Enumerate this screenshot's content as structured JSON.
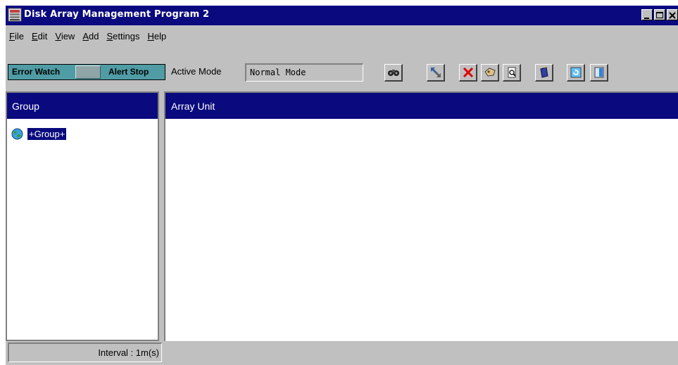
{
  "window": {
    "title": "Disk Array Management Program 2",
    "controls": [
      "minimize-icon",
      "maximize-icon",
      "close-icon"
    ]
  },
  "menu": [
    {
      "label": "File",
      "mnemonic": "F",
      "rest": "ile"
    },
    {
      "label": "Edit",
      "mnemonic": "E",
      "rest": "dit"
    },
    {
      "label": "View",
      "mnemonic": "V",
      "rest": "iew"
    },
    {
      "label": "Add",
      "mnemonic": "A",
      "rest": "dd"
    },
    {
      "label": "Settings",
      "mnemonic": "S",
      "rest": "ettings"
    },
    {
      "label": "Help",
      "mnemonic": "H",
      "rest": "elp"
    }
  ],
  "toolbar": {
    "switch_left": "Error Watch",
    "switch_right": "Alert Stop",
    "active_mode_label": "Active Mode",
    "active_mode_value": "Normal Mode",
    "icons": [
      "binoculars-icon",
      "expand-arrows-icon",
      "delete-x-icon",
      "tag-icon",
      "search-document-icon",
      "book-icon",
      "refresh-icon",
      "exit-door-icon"
    ]
  },
  "left_panel": {
    "header": "Group",
    "items": [
      {
        "label": "+Group+",
        "icon": "globe-icon",
        "selected": true
      }
    ]
  },
  "right_panel": {
    "header": "Array Unit"
  },
  "status": {
    "interval": "Interval : 1m(s)"
  },
  "colors": {
    "title_bar": "#0a0a7e",
    "panel_header": "#0a0a7e",
    "chrome": "#c0c0c0",
    "switch": "#4f9ca5"
  }
}
